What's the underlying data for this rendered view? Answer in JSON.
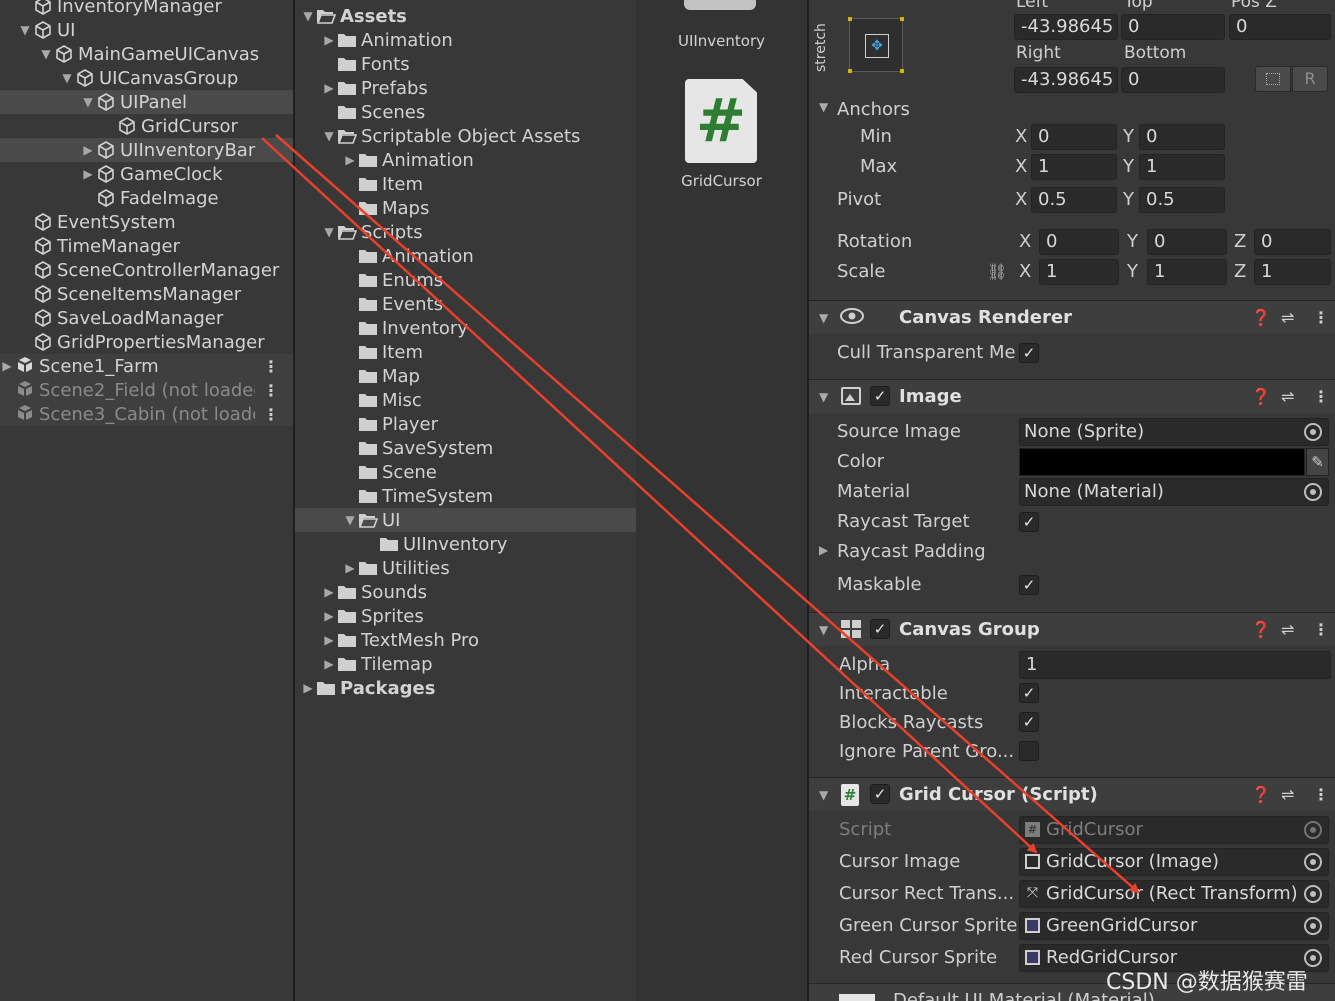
{
  "hierarchy": {
    "items": [
      {
        "label": "InventoryManager",
        "indent": 1,
        "arrow": ""
      },
      {
        "label": "UI",
        "indent": 1,
        "arrow": "▼"
      },
      {
        "label": "MainGameUICanvas",
        "indent": 2,
        "arrow": "▼"
      },
      {
        "label": "UICanvasGroup",
        "indent": 3,
        "arrow": "▼"
      },
      {
        "label": "UIPanel",
        "indent": 4,
        "arrow": "▼",
        "selected": true
      },
      {
        "label": "GridCursor",
        "indent": 5,
        "arrow": ""
      },
      {
        "label": "UIInventoryBar",
        "indent": 4,
        "arrow": "▶",
        "selected": true
      },
      {
        "label": "GameClock",
        "indent": 4,
        "arrow": "▶"
      },
      {
        "label": "FadeImage",
        "indent": 4,
        "arrow": ""
      },
      {
        "label": "EventSystem",
        "indent": 1,
        "arrow": ""
      },
      {
        "label": "TimeManager",
        "indent": 1,
        "arrow": ""
      },
      {
        "label": "SceneControllerManager",
        "indent": 1,
        "arrow": ""
      },
      {
        "label": "SceneItemsManager",
        "indent": 1,
        "arrow": ""
      },
      {
        "label": "SaveLoadManager",
        "indent": 1,
        "arrow": ""
      },
      {
        "label": "GridPropertiesManager",
        "indent": 1,
        "arrow": ""
      }
    ],
    "scenes": [
      {
        "label": "Scene1_Farm",
        "dim": false
      },
      {
        "label": "Scene2_Field (not loaded",
        "dim": true
      },
      {
        "label": "Scene3_Cabin (not loaded",
        "dim": true
      }
    ]
  },
  "project": {
    "items": [
      {
        "label": "Assets",
        "indent": 0,
        "arrow": "▼",
        "bold": true,
        "open": true
      },
      {
        "label": "Animation",
        "indent": 1,
        "arrow": "▶"
      },
      {
        "label": "Fonts",
        "indent": 1,
        "arrow": ""
      },
      {
        "label": "Prefabs",
        "indent": 1,
        "arrow": "▶"
      },
      {
        "label": "Scenes",
        "indent": 1,
        "arrow": ""
      },
      {
        "label": "Scriptable Object Assets",
        "indent": 1,
        "arrow": "▼",
        "open": true
      },
      {
        "label": "Animation",
        "indent": 2,
        "arrow": "▶"
      },
      {
        "label": "Item",
        "indent": 2,
        "arrow": ""
      },
      {
        "label": "Maps",
        "indent": 2,
        "arrow": ""
      },
      {
        "label": "Scripts",
        "indent": 1,
        "arrow": "▼",
        "open": true
      },
      {
        "label": "Animation",
        "indent": 2,
        "arrow": ""
      },
      {
        "label": "Enums",
        "indent": 2,
        "arrow": ""
      },
      {
        "label": "Events",
        "indent": 2,
        "arrow": ""
      },
      {
        "label": "Inventory",
        "indent": 2,
        "arrow": ""
      },
      {
        "label": "Item",
        "indent": 2,
        "arrow": ""
      },
      {
        "label": "Map",
        "indent": 2,
        "arrow": ""
      },
      {
        "label": "Misc",
        "indent": 2,
        "arrow": ""
      },
      {
        "label": "Player",
        "indent": 2,
        "arrow": ""
      },
      {
        "label": "SaveSystem",
        "indent": 2,
        "arrow": ""
      },
      {
        "label": "Scene",
        "indent": 2,
        "arrow": ""
      },
      {
        "label": "TimeSystem",
        "indent": 2,
        "arrow": ""
      },
      {
        "label": "UI",
        "indent": 2,
        "arrow": "▼",
        "open": true,
        "selected": true
      },
      {
        "label": "UIInventory",
        "indent": 3,
        "arrow": ""
      },
      {
        "label": "Utilities",
        "indent": 2,
        "arrow": "▶"
      },
      {
        "label": "Sounds",
        "indent": 1,
        "arrow": "▶"
      },
      {
        "label": "Sprites",
        "indent": 1,
        "arrow": "▶"
      },
      {
        "label": "TextMesh Pro",
        "indent": 1,
        "arrow": "▶"
      },
      {
        "label": "Tilemap",
        "indent": 1,
        "arrow": "▶"
      },
      {
        "label": "Packages",
        "indent": 0,
        "arrow": "▶",
        "bold": true
      }
    ]
  },
  "assets_grid": {
    "items": [
      {
        "label": "UIInventory",
        "kind": "folder"
      },
      {
        "label": "GridCursor",
        "kind": "script"
      }
    ]
  },
  "inspector": {
    "rect": {
      "stretch_label": "stretch",
      "col_left": "Left",
      "col_top": "Top",
      "col_posz": "Pos Z",
      "left": "-43.98645",
      "top": "0",
      "posz": "0",
      "col_right": "Right",
      "col_bottom": "Bottom",
      "right": "-43.98645",
      "bottom": "0",
      "r_button": "R"
    },
    "anchors": {
      "title": "Anchors",
      "min_label": "Min",
      "min_x": "0",
      "min_y": "0",
      "max_label": "Max",
      "max_x": "1",
      "max_y": "1"
    },
    "pivot": {
      "label": "Pivot",
      "x": "0.5",
      "y": "0.5"
    },
    "rotation": {
      "label": "Rotation",
      "x": "0",
      "y": "0",
      "z": "0"
    },
    "scale": {
      "label": "Scale",
      "x": "1",
      "y": "1",
      "z": "1"
    },
    "axis": {
      "x": "X",
      "y": "Y",
      "z": "Z"
    },
    "canvas_renderer": {
      "title": "Canvas Renderer",
      "cull_label": "Cull Transparent Me",
      "cull_checked": true
    },
    "image": {
      "title": "Image",
      "source_label": "Source Image",
      "source_value": "None (Sprite)",
      "color_label": "Color",
      "color_value": "#000000",
      "material_label": "Material",
      "material_value": "None (Material)",
      "raycast_target_label": "Raycast Target",
      "raycast_padding_label": "Raycast Padding",
      "maskable_label": "Maskable"
    },
    "canvas_group": {
      "title": "Canvas Group",
      "alpha_label": "Alpha",
      "alpha_value": "1",
      "interactable_label": "Interactable",
      "blocks_label": "Blocks Raycasts",
      "ignore_label": "Ignore Parent Gro..."
    },
    "grid_cursor": {
      "title": "Grid Cursor (Script)",
      "script_label": "Script",
      "script_value": "GridCursor",
      "cursor_image_label": "Cursor Image",
      "cursor_image_value": "GridCursor (Image)",
      "cursor_rect_label": "Cursor Rect Trans...",
      "cursor_rect_value": "GridCursor (Rect Transform)",
      "green_label": "Green Cursor Sprite",
      "green_value": "GreenGridCursor",
      "red_label": "Red Cursor Sprite",
      "red_value": "RedGridCursor"
    },
    "default_material": "Default UI Material (Material)"
  },
  "watermark": "CSDN @数据猴赛雷",
  "colors": {
    "annotation_arrow": "#e8402a",
    "selection": "#4a4a4a",
    "script_green": "#2e7d32"
  }
}
